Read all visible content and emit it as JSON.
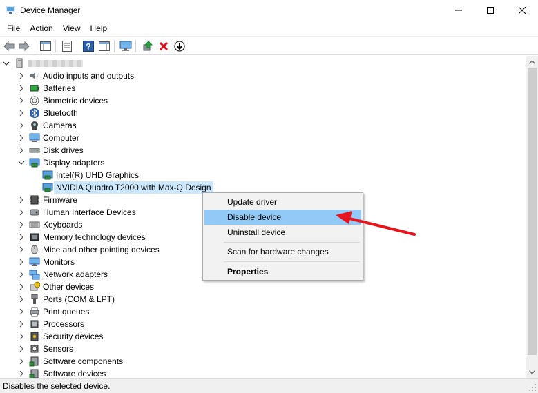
{
  "window": {
    "title": "Device Manager"
  },
  "menu": [
    "File",
    "Action",
    "View",
    "Help"
  ],
  "tree": {
    "categories": [
      {
        "label": "Audio inputs and outputs",
        "icon": "speaker-icon"
      },
      {
        "label": "Batteries",
        "icon": "battery-icon"
      },
      {
        "label": "Biometric devices",
        "icon": "biometric-icon"
      },
      {
        "label": "Bluetooth",
        "icon": "bluetooth-icon"
      },
      {
        "label": "Cameras",
        "icon": "camera-icon"
      },
      {
        "label": "Computer",
        "icon": "computer-icon"
      },
      {
        "label": "Disk drives",
        "icon": "disk-icon"
      },
      {
        "label": "Display adapters",
        "icon": "display-adapter-icon",
        "expanded": true
      },
      {
        "label": "Intel(R) UHD Graphics",
        "icon": "display-adapter-icon",
        "child": true
      },
      {
        "label": "NVIDIA Quadro T2000 with Max-Q Design",
        "icon": "display-adapter-icon",
        "child": true,
        "selected": true
      },
      {
        "label": "Firmware",
        "icon": "firmware-icon"
      },
      {
        "label": "Human Interface Devices",
        "icon": "hid-icon"
      },
      {
        "label": "Keyboards",
        "icon": "keyboard-icon"
      },
      {
        "label": "Memory technology devices",
        "icon": "memory-icon"
      },
      {
        "label": "Mice and other pointing devices",
        "icon": "mouse-icon"
      },
      {
        "label": "Monitors",
        "icon": "monitor-icon"
      },
      {
        "label": "Network adapters",
        "icon": "network-icon"
      },
      {
        "label": "Other devices",
        "icon": "other-devices-icon"
      },
      {
        "label": "Ports (COM & LPT)",
        "icon": "port-icon"
      },
      {
        "label": "Print queues",
        "icon": "printer-icon"
      },
      {
        "label": "Processors",
        "icon": "processor-icon"
      },
      {
        "label": "Security devices",
        "icon": "security-icon"
      },
      {
        "label": "Sensors",
        "icon": "sensor-icon"
      },
      {
        "label": "Software components",
        "icon": "software-icon"
      },
      {
        "label": "Software devices",
        "icon": "software-icon"
      }
    ]
  },
  "context_menu": {
    "items": [
      "Update driver",
      "Disable device",
      "Uninstall device",
      "Scan for hardware changes",
      "Properties"
    ],
    "highlighted": "Disable device"
  },
  "status": {
    "text": "Disables the selected device."
  },
  "colors": {
    "selection": "#cce8ff",
    "menu_hover": "#91c9f7",
    "arrow": "#e8141c"
  }
}
